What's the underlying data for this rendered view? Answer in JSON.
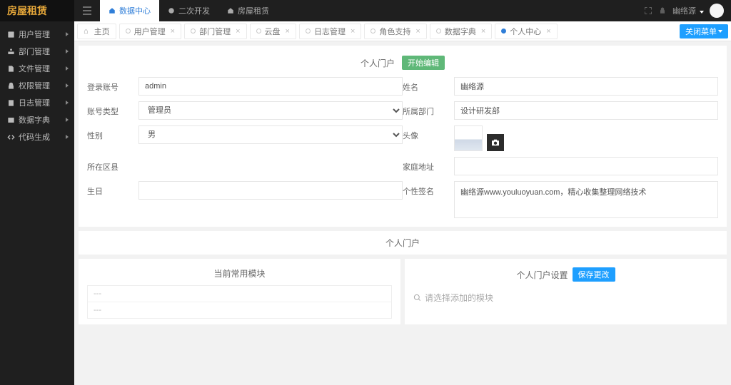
{
  "brand": "房屋租赁",
  "sidebar": {
    "items": [
      {
        "label": "用户管理"
      },
      {
        "label": "部门管理"
      },
      {
        "label": "文件管理"
      },
      {
        "label": "权限管理"
      },
      {
        "label": "日志管理"
      },
      {
        "label": "数据字典"
      },
      {
        "label": "代码生成"
      }
    ]
  },
  "nav": {
    "tabs": [
      {
        "label": "数据中心"
      },
      {
        "label": "二次开发"
      },
      {
        "label": "房屋租赁"
      }
    ]
  },
  "header": {
    "username": "幽络源"
  },
  "tabs": [
    {
      "label": "主页"
    },
    {
      "label": "用户管理"
    },
    {
      "label": "部门管理"
    },
    {
      "label": "云盘"
    },
    {
      "label": "日志管理"
    },
    {
      "label": "角色支持"
    },
    {
      "label": "数据字典"
    },
    {
      "label": "个人中心"
    }
  ],
  "closeMenu": "关闭菜单",
  "profile": {
    "title": "个人门户",
    "editBtn": "开始编辑",
    "labels": {
      "account": "登录账号",
      "name": "姓名",
      "accType": "账号类型",
      "dept": "所属部门",
      "gender": "性别",
      "avatar": "头像",
      "district": "所在区县",
      "addr": "家庭地址",
      "birthday": "生日",
      "sign": "个性签名"
    },
    "values": {
      "account": "admin",
      "name": "幽络源",
      "accType": "管理员",
      "dept": "设计研发部",
      "gender": "男",
      "sign": "幽络源www.youluoyuan.com，精心收集整理网络技术"
    }
  },
  "portal": {
    "title": "个人门户",
    "left": {
      "title": "当前常用模块",
      "row": "---"
    },
    "right": {
      "title": "个人门户设置",
      "saveBtn": "保存更改",
      "placeholder": "请选择添加的模块"
    }
  }
}
